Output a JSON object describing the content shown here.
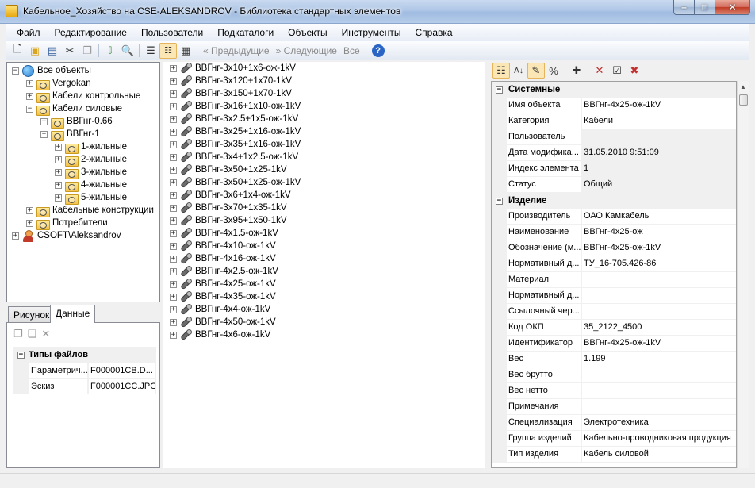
{
  "window": {
    "title": "Кабельное_Хозяйство на CSE-ALEKSANDROV - Библиотека стандартных элементов",
    "buttons": {
      "minimize": "–",
      "maximize": "□",
      "close": "✕"
    }
  },
  "menu": [
    "Файл",
    "Редактирование",
    "Пользователи",
    "Подкаталоги",
    "Объекты",
    "Инструменты",
    "Справка"
  ],
  "toolbar": {
    "prev_label": "Предыдущие",
    "next_label": "Следующие",
    "all_label": "Все",
    "help": "?"
  },
  "tree": [
    {
      "label": "Все объекты",
      "level": 0,
      "expander": "−",
      "icon": "globe-icon"
    },
    {
      "label": "Vergokan",
      "level": 1,
      "expander": "+",
      "icon": "folder-icon"
    },
    {
      "label": "Кабели контрольные",
      "level": 1,
      "expander": "+",
      "icon": "folder-icon"
    },
    {
      "label": "Кабели силовые",
      "level": 1,
      "expander": "−",
      "icon": "folder-icon"
    },
    {
      "label": "ВВГнг-0.66",
      "level": 2,
      "expander": "+",
      "icon": "folder-icon"
    },
    {
      "label": "ВВГнг-1",
      "level": 2,
      "expander": "−",
      "icon": "folder-icon"
    },
    {
      "label": "1-жильные",
      "level": 3,
      "expander": "+",
      "icon": "folder-icon"
    },
    {
      "label": "2-жильные",
      "level": 3,
      "expander": "+",
      "icon": "folder-icon"
    },
    {
      "label": "3-жильные",
      "level": 3,
      "expander": "+",
      "icon": "folder-icon"
    },
    {
      "label": "4-жильные",
      "level": 3,
      "expander": "+",
      "icon": "folder-icon"
    },
    {
      "label": "5-жильные",
      "level": 3,
      "expander": "+",
      "icon": "folder-icon"
    },
    {
      "label": "Кабельные конструкции",
      "level": 1,
      "expander": "+",
      "icon": "folder-icon"
    },
    {
      "label": "Потребители",
      "level": 1,
      "expander": "+",
      "icon": "folder-icon"
    },
    {
      "label": "CSOFT\\Aleksandrov",
      "level": 0,
      "expander": "+",
      "icon": "user-icon"
    }
  ],
  "objects": [
    "ВВГнг-3x10+1x6-ож-1kV",
    "ВВГнг-3x120+1x70-1kV",
    "ВВГнг-3x150+1x70-1kV",
    "ВВГнг-3x16+1x10-ож-1kV",
    "ВВГнг-3x2.5+1x5-ож-1kV",
    "ВВГнг-3x25+1x16-ож-1kV",
    "ВВГнг-3x35+1x16-ож-1kV",
    "ВВГнг-3x4+1x2.5-ож-1kV",
    "ВВГнг-3x50+1x25-1kV",
    "ВВГнг-3x50+1x25-ож-1kV",
    "ВВГнг-3x6+1x4-ож-1kV",
    "ВВГнг-3x70+1x35-1kV",
    "ВВГнг-3x95+1x50-1kV",
    "ВВГнг-4x1.5-ож-1kV",
    "ВВГнг-4x10-ож-1kV",
    "ВВГнг-4x16-ож-1kV",
    "ВВГнг-4x2.5-ож-1kV",
    "ВВГнг-4x25-ож-1kV",
    "ВВГнг-4x35-ож-1kV",
    "ВВГнг-4x4-ож-1kV",
    "ВВГнг-4x50-ож-1kV",
    "ВВГнг-4x6-ож-1kV"
  ],
  "tabs": {
    "picture": "Рисунок",
    "data": "Данные",
    "file_types_header": "Типы файлов",
    "files": [
      {
        "name": "Параметрич...",
        "value": "F000001CB.D..."
      },
      {
        "name": "Эскиз",
        "value": "F000001CC.JPG"
      }
    ]
  },
  "properties": [
    {
      "category": "Системные",
      "rows": [
        {
          "name": "Имя объекта",
          "value": "ВВГнг-4x25-ож-1kV",
          "readonly": false
        },
        {
          "name": "Категория",
          "value": "Кабели",
          "readonly": false
        },
        {
          "name": "Пользователь",
          "value": "",
          "readonly": true
        },
        {
          "name": "Дата модифика...",
          "value": "31.05.2010 9:51:09",
          "readonly": true
        },
        {
          "name": "Индекс элемента",
          "value": "1",
          "readonly": true
        },
        {
          "name": "Статус",
          "value": "Общий",
          "readonly": true
        }
      ]
    },
    {
      "category": "Изделие",
      "rows": [
        {
          "name": "Производитель",
          "value": "ОАО Камкабель",
          "readonly": false
        },
        {
          "name": "Наименование",
          "value": "ВВГнг-4x25-ож",
          "readonly": false
        },
        {
          "name": "Обозначение (м...",
          "value": "ВВГнг-4x25-ож-1kV",
          "readonly": false
        },
        {
          "name": "Нормативный д...",
          "value": "ТУ_16-705.426-86",
          "readonly": false
        },
        {
          "name": "Материал",
          "value": "",
          "readonly": false
        },
        {
          "name": "Нормативный д...",
          "value": "",
          "readonly": false
        },
        {
          "name": "Ссылочный чер...",
          "value": "",
          "readonly": false
        },
        {
          "name": "Код ОКП",
          "value": "35_2122_4500",
          "readonly": false
        },
        {
          "name": "Идентификатор",
          "value": "ВВГнг-4x25-ож-1kV",
          "readonly": false
        },
        {
          "name": "Вес",
          "value": "1.199",
          "readonly": false
        },
        {
          "name": "Вес брутто",
          "value": "",
          "readonly": false
        },
        {
          "name": "Вес нетто",
          "value": "",
          "readonly": false
        },
        {
          "name": "Примечания",
          "value": "",
          "readonly": false
        },
        {
          "name": "Специализация",
          "value": "Электротехника",
          "readonly": false
        },
        {
          "name": "Группа изделий",
          "value": "Кабельно-проводниковая продукция",
          "readonly": false
        },
        {
          "name": "Тип изделия",
          "value": "Кабель силовой",
          "readonly": false
        }
      ]
    }
  ]
}
